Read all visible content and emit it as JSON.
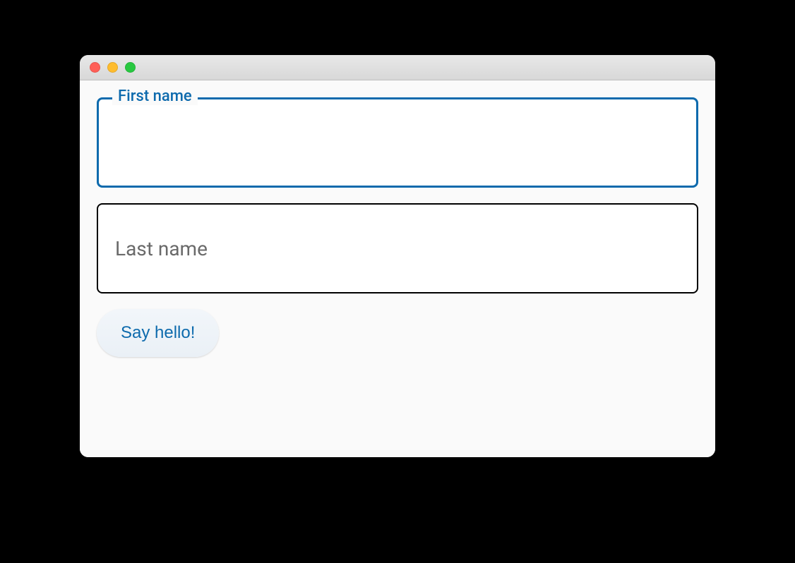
{
  "fields": {
    "first_name": {
      "label": "First name",
      "value": ""
    },
    "last_name": {
      "placeholder": "Last name",
      "value": ""
    }
  },
  "button": {
    "label": "Say hello!"
  }
}
